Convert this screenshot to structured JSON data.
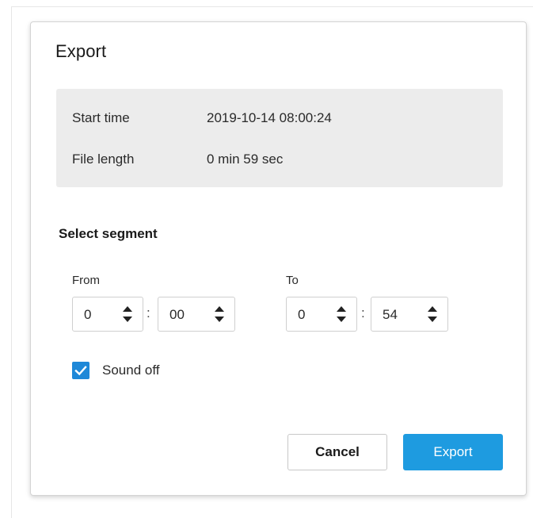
{
  "dialog": {
    "title": "Export"
  },
  "info": {
    "start_time_label": "Start time",
    "start_time_value": "2019-10-14 08:00:24",
    "file_length_label": "File length",
    "file_length_value": "0 min 59 sec"
  },
  "segment": {
    "heading": "Select segment",
    "from": {
      "label": "From",
      "minutes": "0",
      "seconds": "00"
    },
    "to": {
      "label": "To",
      "minutes": "0",
      "seconds": "54"
    },
    "separator": ":"
  },
  "sound_off": {
    "label": "Sound off",
    "checked": true
  },
  "buttons": {
    "cancel": "Cancel",
    "export": "Export"
  },
  "colors": {
    "accent": "#1e9be0",
    "checkbox": "#1e88d8",
    "panel": "#ececec"
  },
  "icons": {
    "spinner": "up-down-arrows-icon",
    "checkbox": "checkmark-icon"
  }
}
